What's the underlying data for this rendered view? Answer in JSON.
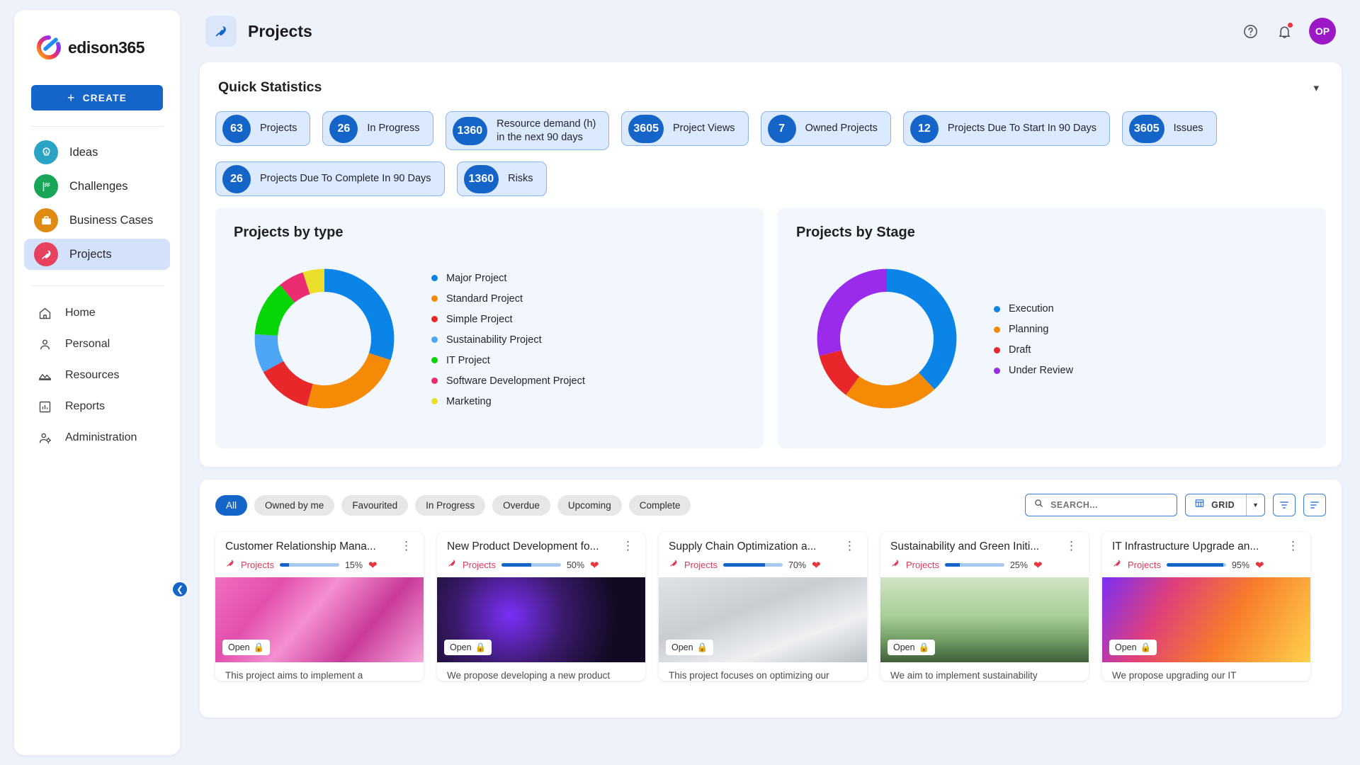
{
  "brand": {
    "name": "edison365"
  },
  "sidebar": {
    "create_label": "CREATE",
    "primary": [
      {
        "label": "Ideas",
        "icon": "lightbulb-icon",
        "color": "#2aa3c4"
      },
      {
        "label": "Challenges",
        "icon": "flag-icon",
        "color": "#18a558"
      },
      {
        "label": "Business Cases",
        "icon": "briefcase-icon",
        "color": "#df8a11"
      },
      {
        "label": "Projects",
        "icon": "rocket-icon",
        "color": "#e8415e",
        "active": true
      }
    ],
    "secondary": [
      {
        "label": "Home",
        "icon": "home-icon"
      },
      {
        "label": "Personal",
        "icon": "person-icon"
      },
      {
        "label": "Resources",
        "icon": "mountains-icon"
      },
      {
        "label": "Reports",
        "icon": "chart-bar-icon"
      },
      {
        "label": "Administration",
        "icon": "admin-users-icon"
      }
    ]
  },
  "topbar": {
    "title": "Projects",
    "page_icon": "rocket-icon",
    "help_icon": "help-circle-icon",
    "notification_icon": "bell-icon",
    "avatar_initials": "OP"
  },
  "quick_statistics": {
    "title": "Quick Statistics",
    "collapse_icon": "chevron-down-icon",
    "rows": [
      [
        {
          "value": "63",
          "label": "Projects"
        },
        {
          "value": "26",
          "label": "In Progress"
        },
        {
          "value": "1360",
          "label": "Resource demand (h)",
          "label2": "in the next 90 days"
        },
        {
          "value": "3605",
          "label": "Project Views"
        },
        {
          "value": "7",
          "label": "Owned Projects"
        },
        {
          "value": "12",
          "label": "Projects Due To Start In 90 Days"
        },
        {
          "value": "3605",
          "label": "Issues"
        }
      ],
      [
        {
          "value": "26",
          "label": "Projects Due To Complete In 90 Days"
        },
        {
          "value": "1360",
          "label": "Risks"
        }
      ]
    ]
  },
  "chart_data": [
    {
      "type": "pie",
      "title": "Projects by type",
      "legend_position": "right",
      "categories": [
        "Major Project",
        "Standard Project",
        "Simple Project",
        "Sustainability Project",
        "IT Project",
        "Software Development Project",
        "Marketing"
      ],
      "values": [
        30,
        24,
        13,
        9,
        13,
        6,
        5
      ],
      "colors": [
        "#0b84e8",
        "#f58a07",
        "#e8272b",
        "#4da6f5",
        "#06d606",
        "#eb2c70",
        "#ecdf2c"
      ]
    },
    {
      "type": "pie",
      "title": "Projects by Stage",
      "legend_position": "right",
      "categories": [
        "Execution",
        "Planning",
        "Draft",
        "Under Review"
      ],
      "values": [
        38,
        22,
        11,
        29
      ],
      "colors": [
        "#0b84e8",
        "#f58a07",
        "#e8272b",
        "#9a2bea"
      ]
    }
  ],
  "list": {
    "filters": [
      {
        "label": "All",
        "active": true
      },
      {
        "label": "Owned by me",
        "active": false
      },
      {
        "label": "Favourited",
        "active": false
      },
      {
        "label": "In Progress",
        "active": false
      },
      {
        "label": "Overdue",
        "active": false
      },
      {
        "label": "Upcoming",
        "active": false
      },
      {
        "label": "Complete",
        "active": false
      }
    ],
    "search_placeholder": "SEARCH...",
    "search_value": "",
    "search_icon": "search-icon",
    "view_label": "GRID",
    "view_icon": "grid-icon",
    "view_caret_icon": "caret-down-icon",
    "filter_icon": "funnel-icon",
    "sort_icon": "sort-icon",
    "cards": [
      {
        "title": "Customer Relationship Mana...",
        "tag": "Projects",
        "progress": "15%",
        "progress_value": 15,
        "status": "Open",
        "status_icon": "lock-icon",
        "description": "This project aims to implement a",
        "thumb": "pink-waves"
      },
      {
        "title": "New Product Development fo...",
        "tag": "Projects",
        "progress": "50%",
        "progress_value": 50,
        "status": "Open",
        "status_icon": "lock-icon",
        "description": "We propose developing a new product",
        "thumb": "dark-spheres"
      },
      {
        "title": "Supply Chain Optimization a...",
        "tag": "Projects",
        "progress": "70%",
        "progress_value": 70,
        "status": "Open",
        "status_icon": "lock-icon",
        "description": "This project focuses on optimizing our",
        "thumb": "desk-charts"
      },
      {
        "title": "Sustainability and Green Initi...",
        "tag": "Projects",
        "progress": "25%",
        "progress_value": 25,
        "status": "Open",
        "status_icon": "lock-icon",
        "description": "We aim to implement sustainability",
        "thumb": "wind-turbines"
      },
      {
        "title": "IT Infrastructure Upgrade an...",
        "tag": "Projects",
        "progress": "95%",
        "progress_value": 95,
        "status": "Open",
        "status_icon": "lock-icon",
        "description": "We propose upgrading our IT",
        "thumb": "orange-gradient"
      }
    ]
  }
}
